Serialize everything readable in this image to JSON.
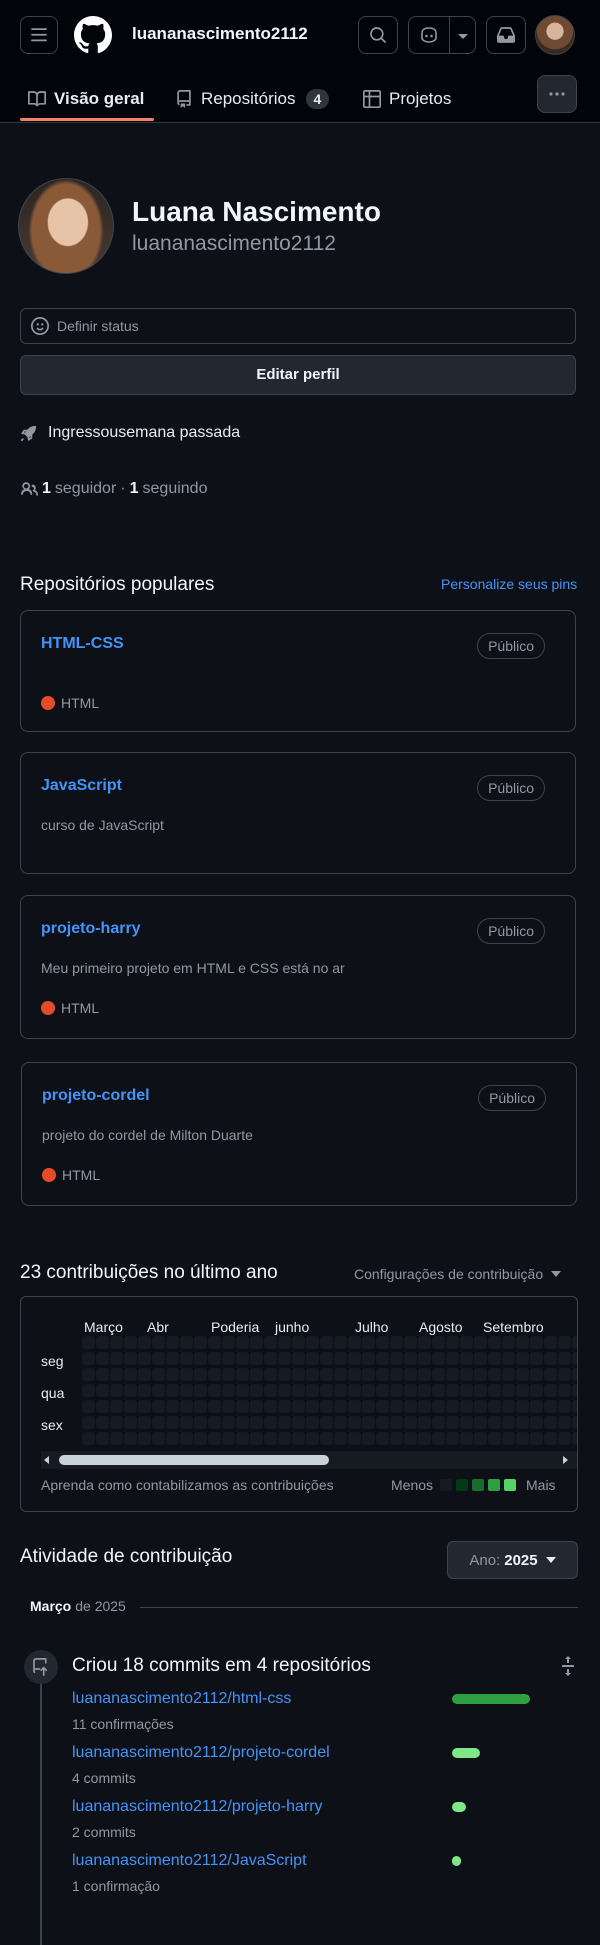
{
  "header": {
    "username": "luananascimento2112",
    "tabs": [
      {
        "label": "Visão geral",
        "icon": "book-icon"
      },
      {
        "label": "Repositórios",
        "icon": "repo-icon",
        "count": "4"
      },
      {
        "label": "Projetos",
        "icon": "table-icon"
      }
    ]
  },
  "profile": {
    "name": "Luana Nascimento",
    "login": "luananascimento2112",
    "status_label": "Definir status",
    "edit_label": "Editar perfil",
    "joined_prefix": "Ingressou",
    "joined_value": "semana passada",
    "followers_count": "1",
    "followers_label": "seguidor",
    "following_count": "1",
    "following_label": "seguindo"
  },
  "pinned": {
    "title": "Repositórios populares",
    "customize": "Personalize seus pins",
    "repos": [
      {
        "name": "HTML-CSS",
        "visibility": "Público",
        "description": "",
        "language": "HTML"
      },
      {
        "name": "JavaScript",
        "visibility": "Público",
        "description": "curso de JavaScript",
        "language": ""
      },
      {
        "name": "projeto-harry",
        "visibility": "Público",
        "description": "Meu primeiro projeto em HTML e CSS está no ar",
        "language": "HTML"
      },
      {
        "name": "projeto-cordel",
        "visibility": "Público",
        "description": "projeto do cordel de Milton Duarte",
        "language": "HTML"
      }
    ]
  },
  "contributions": {
    "title": "23 contribuições no último ano",
    "settings": "Configurações de contribuição",
    "months": [
      "Março",
      "Abr",
      "Poderia",
      "junho",
      "Julho",
      "Agosto",
      "Setembro"
    ],
    "days": [
      "seg",
      "qua",
      "sex"
    ],
    "learn": "Aprenda como contabilizamos as contribuições",
    "less": "Menos",
    "more": "Mais",
    "legend_colors": [
      "#151b23",
      "#033a16",
      "#196c2e",
      "#2ea043",
      "#56d364"
    ]
  },
  "activity": {
    "title": "Atividade de contribuição",
    "year_label": "Ano:",
    "year_value": "2025",
    "month": "Março",
    "month_year": "de 2025",
    "summary": "Criou 18 commits em 4 repositórios",
    "items": [
      {
        "repo": "luananascimento2112/html-css",
        "count": "11 confirmações",
        "share": 0.61
      },
      {
        "repo": "luananascimento2112/projeto-cordel",
        "count": "4 commits",
        "share": 0.22
      },
      {
        "repo": "luananascimento2112/projeto-harry",
        "count": "2 commits",
        "share": 0.11
      },
      {
        "repo": "luananascimento2112/JavaScript",
        "count": "1 confirmação",
        "share": 0.06
      }
    ]
  }
}
